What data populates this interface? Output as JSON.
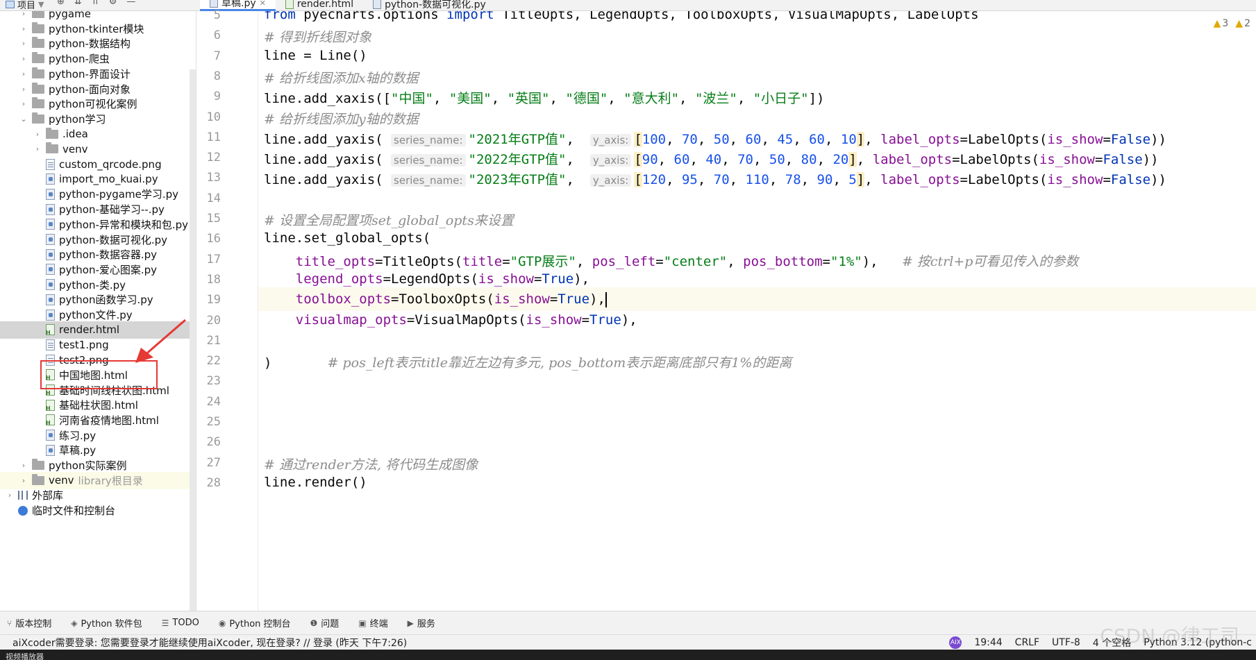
{
  "topbar": {
    "project_label": "项目"
  },
  "tabs": [
    {
      "label": "草稿.py",
      "kind": "py",
      "active": true
    },
    {
      "label": "render.html",
      "kind": "html",
      "active": false
    },
    {
      "label": "python-数据可视化.py",
      "kind": "py",
      "active": false
    }
  ],
  "tree": [
    {
      "label": "pygame",
      "kind": "folder",
      "depth": 1,
      "expand": "closed"
    },
    {
      "label": "python-tkinter模块",
      "kind": "folder",
      "depth": 1,
      "expand": "closed"
    },
    {
      "label": "python-数据结构",
      "kind": "folder",
      "depth": 1,
      "expand": "closed"
    },
    {
      "label": "python-爬虫",
      "kind": "folder",
      "depth": 1,
      "expand": "closed"
    },
    {
      "label": "python-界面设计",
      "kind": "folder",
      "depth": 1,
      "expand": "closed"
    },
    {
      "label": "python-面向对象",
      "kind": "folder",
      "depth": 1,
      "expand": "closed"
    },
    {
      "label": "python可视化案例",
      "kind": "folder",
      "depth": 1,
      "expand": "closed"
    },
    {
      "label": "python学习",
      "kind": "folder",
      "depth": 1,
      "expand": "open"
    },
    {
      "label": ".idea",
      "kind": "folder",
      "depth": 2,
      "expand": "closed"
    },
    {
      "label": "venv",
      "kind": "folder",
      "depth": 2,
      "expand": "closed"
    },
    {
      "label": "custom_qrcode.png",
      "kind": "png",
      "depth": 2
    },
    {
      "label": "import_mo_kuai.py",
      "kind": "py",
      "depth": 2
    },
    {
      "label": "python-pygame学习.py",
      "kind": "py",
      "depth": 2
    },
    {
      "label": "python-基础学习--.py",
      "kind": "py",
      "depth": 2
    },
    {
      "label": "python-异常和模块和包.py",
      "kind": "py",
      "depth": 2
    },
    {
      "label": "python-数据可视化.py",
      "kind": "py",
      "depth": 2
    },
    {
      "label": "python-数据容器.py",
      "kind": "py",
      "depth": 2
    },
    {
      "label": "python-爱心图案.py",
      "kind": "py",
      "depth": 2
    },
    {
      "label": "python-类.py",
      "kind": "py",
      "depth": 2
    },
    {
      "label": "python函数学习.py",
      "kind": "py",
      "depth": 2
    },
    {
      "label": "python文件.py",
      "kind": "py",
      "depth": 2
    },
    {
      "label": "render.html",
      "kind": "html",
      "depth": 2,
      "selected": true
    },
    {
      "label": "test1.png",
      "kind": "png",
      "depth": 2
    },
    {
      "label": "test2.png",
      "kind": "png",
      "depth": 2
    },
    {
      "label": "中国地图.html",
      "kind": "html",
      "depth": 2
    },
    {
      "label": "基础时间线柱状图.html",
      "kind": "html",
      "depth": 2
    },
    {
      "label": "基础柱状图.html",
      "kind": "html",
      "depth": 2
    },
    {
      "label": "河南省疫情地图.html",
      "kind": "html",
      "depth": 2
    },
    {
      "label": "练习.py",
      "kind": "py",
      "depth": 2
    },
    {
      "label": "草稿.py",
      "kind": "py",
      "depth": 2
    },
    {
      "label": "python实际案例",
      "kind": "folder",
      "depth": 1,
      "expand": "closed"
    },
    {
      "label": "venv",
      "kind": "folder",
      "depth": 1,
      "expand": "closed",
      "muted": "library根目录",
      "highlight": true
    },
    {
      "label": "外部库",
      "kind": "lib",
      "depth": 0,
      "expand": "closed"
    },
    {
      "label": "临时文件和控制台",
      "kind": "scratch",
      "depth": 0
    }
  ],
  "editor": {
    "warnings": [
      {
        "icon": "warning-icon",
        "count": "3"
      },
      {
        "icon": "warning-icon",
        "count": "2"
      }
    ],
    "current_line": "19",
    "lines": [
      {
        "n": "5",
        "tokens": [
          [
            "kw",
            "from "
          ],
          [
            "",
            "pyecharts.options "
          ],
          [
            "kw",
            "import "
          ],
          [
            "",
            "TitleOpts, LegendOpts, ToolboxOpts, VisualMapOpts, LabelOpts"
          ]
        ]
      },
      {
        "n": "6",
        "tokens": [
          [
            "cm",
            "# 得到折线图对象"
          ]
        ]
      },
      {
        "n": "7",
        "tokens": [
          [
            "",
            "line = Line()"
          ]
        ]
      },
      {
        "n": "8",
        "tokens": [
          [
            "cm",
            "# 给折线图添加x轴的数据"
          ]
        ]
      },
      {
        "n": "9",
        "tokens": [
          [
            "",
            "line.add_xaxis(["
          ],
          [
            "str",
            "\"中国\""
          ],
          [
            "",
            ", "
          ],
          [
            "str",
            "\"美国\""
          ],
          [
            "",
            ", "
          ],
          [
            "str",
            "\"英国\""
          ],
          [
            "",
            ", "
          ],
          [
            "str",
            "\"德国\""
          ],
          [
            "",
            ", "
          ],
          [
            "str",
            "\"意大利\""
          ],
          [
            "",
            ", "
          ],
          [
            "str",
            "\"波兰\""
          ],
          [
            "",
            ", "
          ],
          [
            "str",
            "\"小日子\""
          ],
          [
            "",
            "])"
          ]
        ]
      },
      {
        "n": "10",
        "tokens": [
          [
            "cm",
            "# 给折线图添加y轴的数据"
          ]
        ]
      },
      {
        "n": "11",
        "tokens": [
          [
            "",
            "line.add_yaxis( "
          ],
          [
            "hint",
            "series_name:"
          ],
          [
            "str",
            "\"2021年GTP值\""
          ],
          [
            "",
            ",  "
          ],
          [
            "hint",
            "y_axis:"
          ],
          [
            "hlarr",
            "["
          ],
          [
            "num",
            "100"
          ],
          [
            "",
            ", "
          ],
          [
            "num",
            "70"
          ],
          [
            "",
            ", "
          ],
          [
            "num",
            "50"
          ],
          [
            "",
            ", "
          ],
          [
            "num",
            "60"
          ],
          [
            "",
            ", "
          ],
          [
            "num",
            "45"
          ],
          [
            "",
            ", "
          ],
          [
            "num",
            "60"
          ],
          [
            "",
            ", "
          ],
          [
            "num",
            "10"
          ],
          [
            "hlarr",
            "]"
          ],
          [
            "",
            ", "
          ],
          [
            "param",
            "label_opts"
          ],
          [
            "",
            "=LabelOpts("
          ],
          [
            "param",
            "is_show"
          ],
          [
            "",
            "="
          ],
          [
            "kw",
            "False"
          ],
          [
            "",
            "))"
          ]
        ]
      },
      {
        "n": "12",
        "tokens": [
          [
            "",
            "line.add_yaxis( "
          ],
          [
            "hint",
            "series_name:"
          ],
          [
            "str",
            "\"2022年GTP值\""
          ],
          [
            "",
            ",  "
          ],
          [
            "hint",
            "y_axis:"
          ],
          [
            "hlarr",
            "["
          ],
          [
            "num",
            "90"
          ],
          [
            "",
            ", "
          ],
          [
            "num",
            "60"
          ],
          [
            "",
            ", "
          ],
          [
            "num",
            "40"
          ],
          [
            "",
            ", "
          ],
          [
            "num",
            "70"
          ],
          [
            "",
            ", "
          ],
          [
            "num",
            "50"
          ],
          [
            "",
            ", "
          ],
          [
            "num",
            "80"
          ],
          [
            "",
            ", "
          ],
          [
            "num",
            "20"
          ],
          [
            "hlarr",
            "]"
          ],
          [
            "",
            ", "
          ],
          [
            "param",
            "label_opts"
          ],
          [
            "",
            "=LabelOpts("
          ],
          [
            "param",
            "is_show"
          ],
          [
            "",
            "="
          ],
          [
            "kw",
            "False"
          ],
          [
            "",
            "))"
          ]
        ]
      },
      {
        "n": "13",
        "tokens": [
          [
            "",
            "line.add_yaxis( "
          ],
          [
            "hint",
            "series_name:"
          ],
          [
            "str",
            "\"2023年GTP值\""
          ],
          [
            "",
            ",  "
          ],
          [
            "hint",
            "y_axis:"
          ],
          [
            "hlarr",
            "["
          ],
          [
            "num",
            "120"
          ],
          [
            "",
            ", "
          ],
          [
            "num",
            "95"
          ],
          [
            "",
            ", "
          ],
          [
            "num",
            "70"
          ],
          [
            "",
            ", "
          ],
          [
            "num",
            "110"
          ],
          [
            "",
            ", "
          ],
          [
            "num",
            "78"
          ],
          [
            "",
            ", "
          ],
          [
            "num",
            "90"
          ],
          [
            "",
            ", "
          ],
          [
            "num",
            "5"
          ],
          [
            "hlarr",
            "]"
          ],
          [
            "",
            ", "
          ],
          [
            "param",
            "label_opts"
          ],
          [
            "",
            "=LabelOpts("
          ],
          [
            "param",
            "is_show"
          ],
          [
            "",
            "="
          ],
          [
            "kw",
            "False"
          ],
          [
            "",
            "))"
          ]
        ]
      },
      {
        "n": "14",
        "tokens": []
      },
      {
        "n": "15",
        "tokens": [
          [
            "cm",
            "# 设置全局配置项set_global_opts来设置"
          ]
        ]
      },
      {
        "n": "16",
        "tokens": [
          [
            "",
            "line.set_global_opts("
          ]
        ]
      },
      {
        "n": "17",
        "tokens": [
          [
            "",
            "    "
          ],
          [
            "param",
            "title_opts"
          ],
          [
            "",
            "=TitleOpts("
          ],
          [
            "param",
            "title"
          ],
          [
            "",
            "="
          ],
          [
            "str",
            "\"GTP展示\""
          ],
          [
            "",
            ", "
          ],
          [
            "param",
            "pos_left"
          ],
          [
            "",
            "="
          ],
          [
            "str",
            "\"center\""
          ],
          [
            "",
            ", "
          ],
          [
            "param",
            "pos_bottom"
          ],
          [
            "",
            "="
          ],
          [
            "str",
            "\"1%\""
          ],
          [
            "",
            "),   "
          ],
          [
            "cm",
            "# 按ctrl+p可看见传入的参数"
          ]
        ]
      },
      {
        "n": "18",
        "tokens": [
          [
            "",
            "    "
          ],
          [
            "param",
            "legend_opts"
          ],
          [
            "",
            "=LegendOpts("
          ],
          [
            "param",
            "is_show"
          ],
          [
            "",
            "="
          ],
          [
            "kw",
            "True"
          ],
          [
            "",
            "),"
          ]
        ]
      },
      {
        "n": "19",
        "tokens": [
          [
            "",
            "    "
          ],
          [
            "param",
            "toolbox_opts"
          ],
          [
            "",
            "=ToolboxOpts("
          ],
          [
            "param",
            "is_show"
          ],
          [
            "",
            "="
          ],
          [
            "kw",
            "True"
          ],
          [
            "",
            "),"
          ],
          [
            "caret",
            ""
          ]
        ]
      },
      {
        "n": "20",
        "tokens": [
          [
            "",
            "    "
          ],
          [
            "param",
            "visualmap_opts"
          ],
          [
            "",
            "=VisualMapOpts("
          ],
          [
            "param",
            "is_show"
          ],
          [
            "",
            "="
          ],
          [
            "kw",
            "True"
          ],
          [
            "",
            "),"
          ]
        ]
      },
      {
        "n": "21",
        "tokens": []
      },
      {
        "n": "22",
        "tokens": [
          [
            "",
            ")       "
          ],
          [
            "cm",
            "# pos_left表示title靠近左边有多元, pos_bottom表示距离底部只有1%的距离"
          ]
        ]
      },
      {
        "n": "23",
        "tokens": []
      },
      {
        "n": "24",
        "tokens": []
      },
      {
        "n": "25",
        "tokens": []
      },
      {
        "n": "26",
        "tokens": []
      },
      {
        "n": "27",
        "tokens": [
          [
            "cm",
            "# 通过render方法, 将代码生成图像"
          ]
        ]
      },
      {
        "n": "28",
        "tokens": [
          [
            "",
            "line.render()"
          ]
        ]
      }
    ]
  },
  "toolwindows": [
    {
      "icon": "vcs-icon",
      "glyph": "⑂",
      "label": "版本控制"
    },
    {
      "icon": "python-packages-icon",
      "glyph": "◈",
      "label": "Python 软件包"
    },
    {
      "icon": "todo-icon",
      "glyph": "☰",
      "label": "TODO"
    },
    {
      "icon": "python-console-icon",
      "glyph": "◉",
      "label": "Python 控制台"
    },
    {
      "icon": "problems-icon",
      "glyph": "❶",
      "label": "问题"
    },
    {
      "icon": "terminal-icon",
      "glyph": "▣",
      "label": "终端"
    },
    {
      "icon": "services-icon",
      "glyph": "▶",
      "label": "服务"
    }
  ],
  "status": {
    "message": "aiXcoder需要登录: 您需要登录才能继续使用aiXcoder, 现在登录?  // 登录 (昨天 下午7:26)",
    "aix": "AIX",
    "position": "19:44",
    "line_sep": "CRLF",
    "encoding": "UTF-8",
    "indent": "4 个空格",
    "interpreter": "Python 3.12 (python-c"
  },
  "taskbar": {
    "first_item": "视频播放器"
  },
  "watermark": "CSDN @律工司"
}
